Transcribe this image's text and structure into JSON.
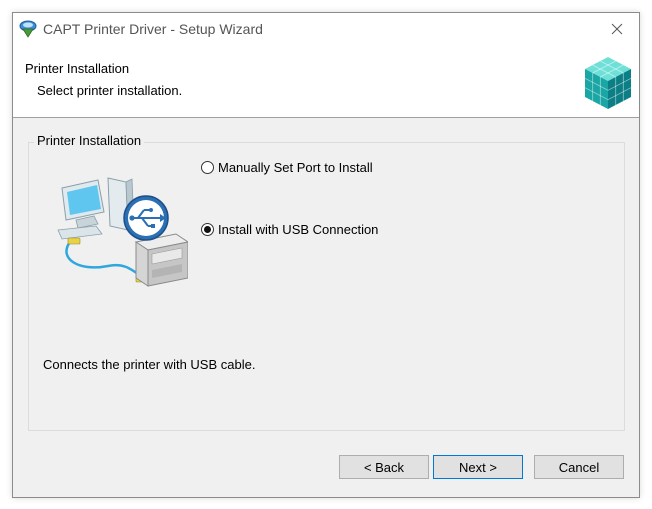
{
  "window": {
    "title": "CAPT Printer Driver - Setup Wizard"
  },
  "header": {
    "title": "Printer Installation",
    "subtitle": "Select printer installation."
  },
  "group": {
    "legend": "Printer Installation",
    "options": [
      {
        "label": "Manually Set Port to Install",
        "checked": false
      },
      {
        "label": "Install with USB Connection",
        "checked": true
      }
    ],
    "description": "Connects the printer with USB cable."
  },
  "buttons": {
    "back": "< Back",
    "next": "Next >",
    "cancel": "Cancel"
  },
  "icons": {
    "app": "setup-wizard-icon",
    "close": "close-icon",
    "logo": "cube-logo-icon",
    "illustration": "usb-printer-illustration"
  },
  "colors": {
    "accent": "#0078d7",
    "usb_badge": "#2b6fb5",
    "logo_teal": "#1fb5b3"
  }
}
